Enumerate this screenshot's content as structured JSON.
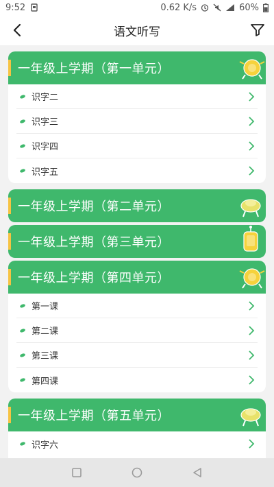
{
  "status": {
    "time": "9:52",
    "network_speed": "0.62 K/s",
    "battery": "60%"
  },
  "header": {
    "title": "语文听写"
  },
  "units": [
    {
      "title": "一年级上学期（第一单元）",
      "lessons": [
        "识字二",
        "识字三",
        "识字四",
        "识字五"
      ]
    },
    {
      "title": "一年级上学期（第二单元）",
      "lessons": []
    },
    {
      "title": "一年级上学期（第三单元）",
      "lessons": []
    },
    {
      "title": "一年级上学期（第四单元）",
      "lessons": [
        "第一课",
        "第二课",
        "第三课",
        "第四课"
      ]
    },
    {
      "title": "一年级上学期（第五单元）",
      "lessons": [
        "识字六"
      ]
    }
  ],
  "colors": {
    "header_green": "#3fb86c",
    "accent_yellow": "#f6c343",
    "chevron_green": "#3fb86c"
  },
  "icons": {
    "back": "chevron-left-icon",
    "filter": "filter-icon",
    "row_bullet": "leaf-icon",
    "row_arrow": "chevron-right-icon"
  }
}
